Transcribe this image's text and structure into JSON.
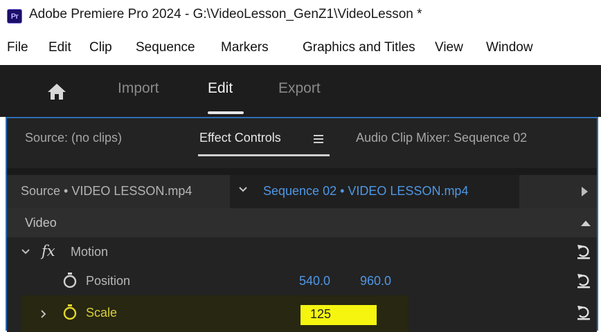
{
  "window": {
    "app_icon_label": "Pr",
    "title": "Adobe Premiere Pro 2024 - G:\\VideoLesson_GenZ1\\VideoLesson *"
  },
  "menu": [
    "File",
    "Edit",
    "Clip",
    "Sequence",
    "Markers",
    "Graphics and Titles",
    "View",
    "Window"
  ],
  "workspace": {
    "home_icon": "home-icon",
    "tabs": [
      {
        "label": "Import",
        "active": false
      },
      {
        "label": "Edit",
        "active": true
      },
      {
        "label": "Export",
        "active": false
      }
    ]
  },
  "panel_tabs": [
    {
      "label": "Source: (no clips)",
      "active": false
    },
    {
      "label": "Effect Controls",
      "active": true,
      "menu_icon": "hamburger-menu-icon"
    },
    {
      "label": "Audio Clip Mixer: Sequence 02",
      "active": false
    }
  ],
  "clip_bar": {
    "source_clip": "Source • VIDEO LESSON.mp4",
    "sequence_clip": "Sequence 02 • VIDEO LESSON.mp4"
  },
  "effects": {
    "section_label": "Video",
    "motion": {
      "fx_symbol": "fx",
      "label": "Motion"
    },
    "position": {
      "label": "Position",
      "x": "540.0",
      "y": "960.0"
    },
    "scale": {
      "label": "Scale",
      "value": "125"
    }
  },
  "colors": {
    "accent_blue": "#4f97e6",
    "panel_border": "#2d6db5",
    "scale_highlight": "#f5f510",
    "keyframe_stopwatch_active": "#e3d62a"
  }
}
